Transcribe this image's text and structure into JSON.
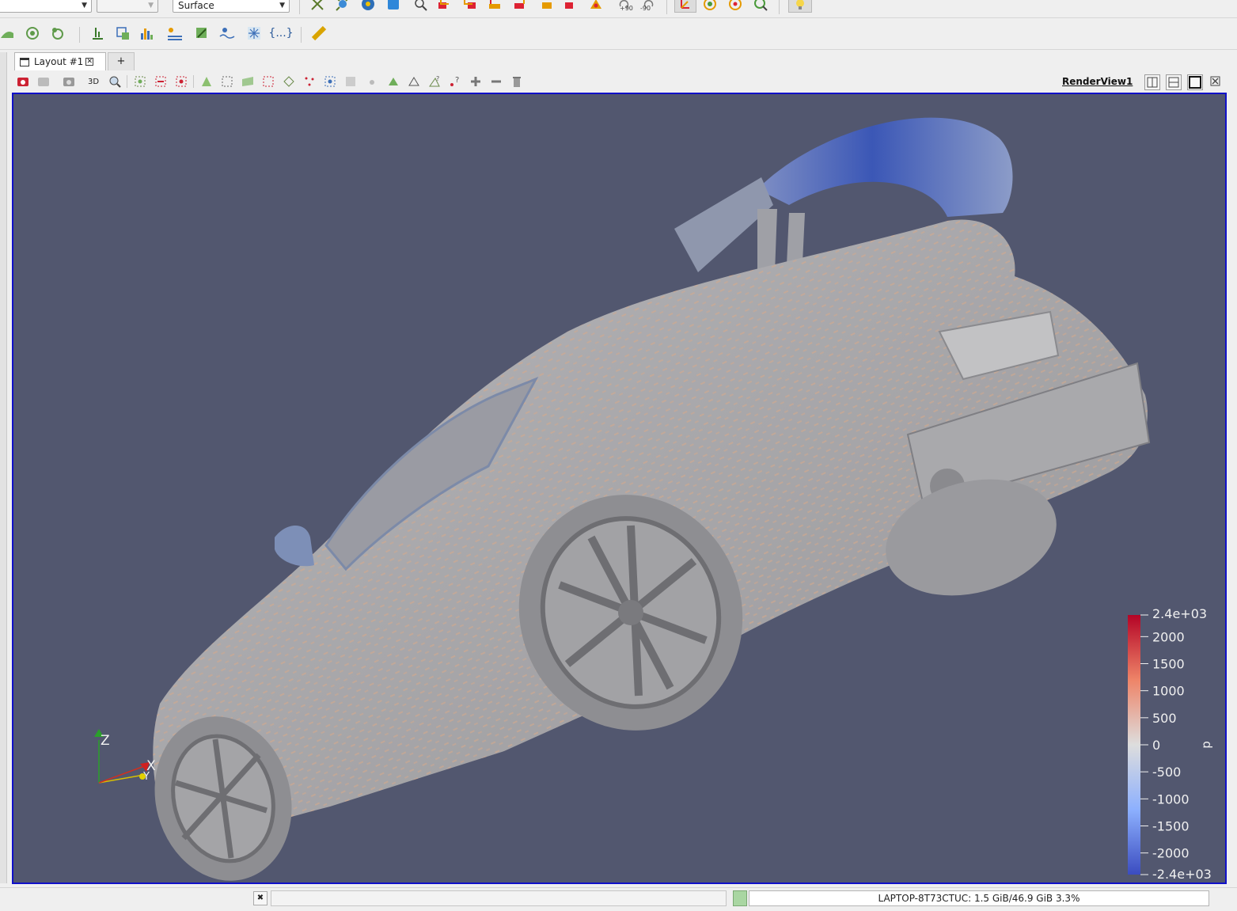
{
  "toolbar": {
    "representation_value": "Surface",
    "rotate_plus_label": "+90",
    "rotate_minus_label": "-90"
  },
  "tabs": {
    "layout_label": "Layout #1",
    "new_tab_label": "+"
  },
  "view_toolbar": {
    "mode_label": "3D",
    "view_name": "RenderView1"
  },
  "orientation_axes": {
    "z": "Z",
    "x": "X",
    "y": "Y"
  },
  "color_legend": {
    "title": "p",
    "max_label": "2.4e+03",
    "min_label": "-2.4e+03",
    "ticks": [
      "2000",
      "1500",
      "1000",
      "500",
      "0",
      "-500",
      "-1000",
      "-1500",
      "-2000"
    ],
    "color_max": "#b40426",
    "color_mid": "#dddddd",
    "color_min": "#3b4cc0"
  },
  "render": {
    "background": "#52576f",
    "surface_color": "#a9a9ad"
  },
  "status": {
    "memory_text": "LAPTOP-8T73CTUC: 1.5 GiB/46.9 GiB 3.3%"
  }
}
